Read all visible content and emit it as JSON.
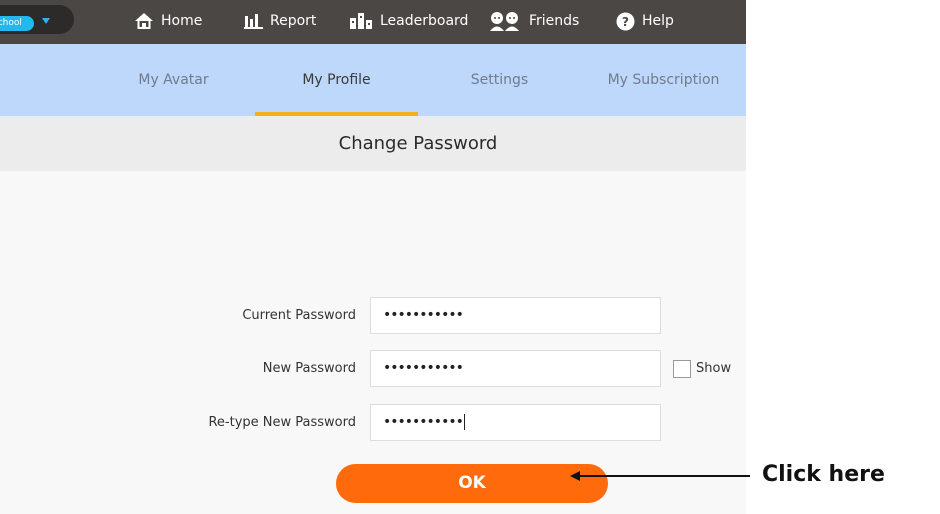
{
  "topbar": {
    "school_label": "School",
    "nav": [
      {
        "label": "Home",
        "icon": "home-icon"
      },
      {
        "label": "Report",
        "icon": "bar-chart-icon"
      },
      {
        "label": "Leaderboard",
        "icon": "leaderboard-icon"
      },
      {
        "label": "Friends",
        "icon": "friends-icon"
      },
      {
        "label": "Help",
        "icon": "help-icon"
      }
    ]
  },
  "tabs": [
    {
      "label": "My Avatar",
      "active": false
    },
    {
      "label": "My Profile",
      "active": true
    },
    {
      "label": "Settings",
      "active": false
    },
    {
      "label": "My Subscription",
      "active": false
    }
  ],
  "section": {
    "title": "Change Password"
  },
  "form": {
    "current_label": "Current Password",
    "current_value": "•••••••••••",
    "new_label": "New Password",
    "new_value": "•••••••••••",
    "retype_label": "Re-type New Password",
    "retype_value": "•••••••••••",
    "show_label": "Show",
    "show_checked": false,
    "ok_label": "OK"
  },
  "annotation": {
    "text": "Click here"
  },
  "colors": {
    "topbar": "#4a4745",
    "tab_bar": "#bdd8fa",
    "active_tab_underline": "#f3b117",
    "ok_button": "#ff6a0d",
    "school_badge": "#22b8f0"
  }
}
